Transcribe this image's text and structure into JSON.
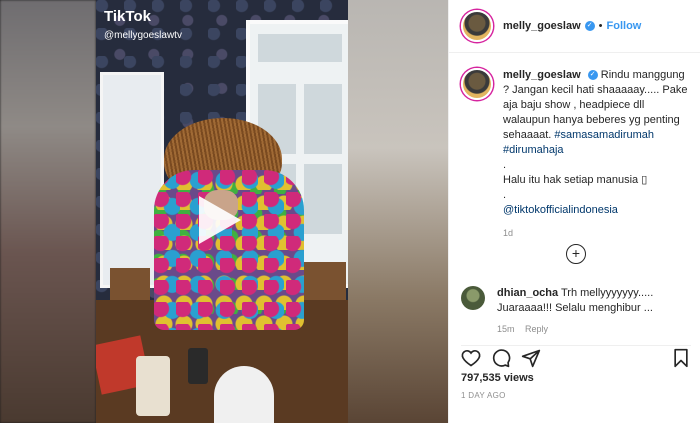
{
  "tiktok": {
    "logo": "TikTok",
    "user": "@mellygoeslawtv"
  },
  "header": {
    "username": "melly_goeslaw",
    "separator": "•",
    "follow": "Follow"
  },
  "caption": {
    "username": "melly_goeslaw",
    "line1": "Rindu manggung ? Jangan kecil hati shaaaaay..... Pake aja baju show , headpiece dll walaupun hanya beberes yg penting sehaaaat.",
    "tag1": "#samasamadirumah",
    "tag2": "#dirumahaja",
    "dot1": ".",
    "line2": "Halu itu hak setiap manusia ▯",
    "dot2": ".",
    "mention": "@tiktokofficialindonesia",
    "time": "1d"
  },
  "load_more": "+",
  "comment": {
    "username": "dhian_ocha",
    "text": "Trh mellyyyyyyy..... Juaraaaa!!! Selalu menghibur ...",
    "time": "15m",
    "reply": "Reply"
  },
  "actions": {
    "like_icon": "heart-icon",
    "comment_icon": "comment-icon",
    "share_icon": "share-icon",
    "save_icon": "bookmark-icon"
  },
  "stats": {
    "views": "797,535 views",
    "posted": "1 DAY AGO"
  },
  "colors": {
    "accent": "#3897f0",
    "text": "#262626",
    "muted": "#8e8e8e"
  }
}
